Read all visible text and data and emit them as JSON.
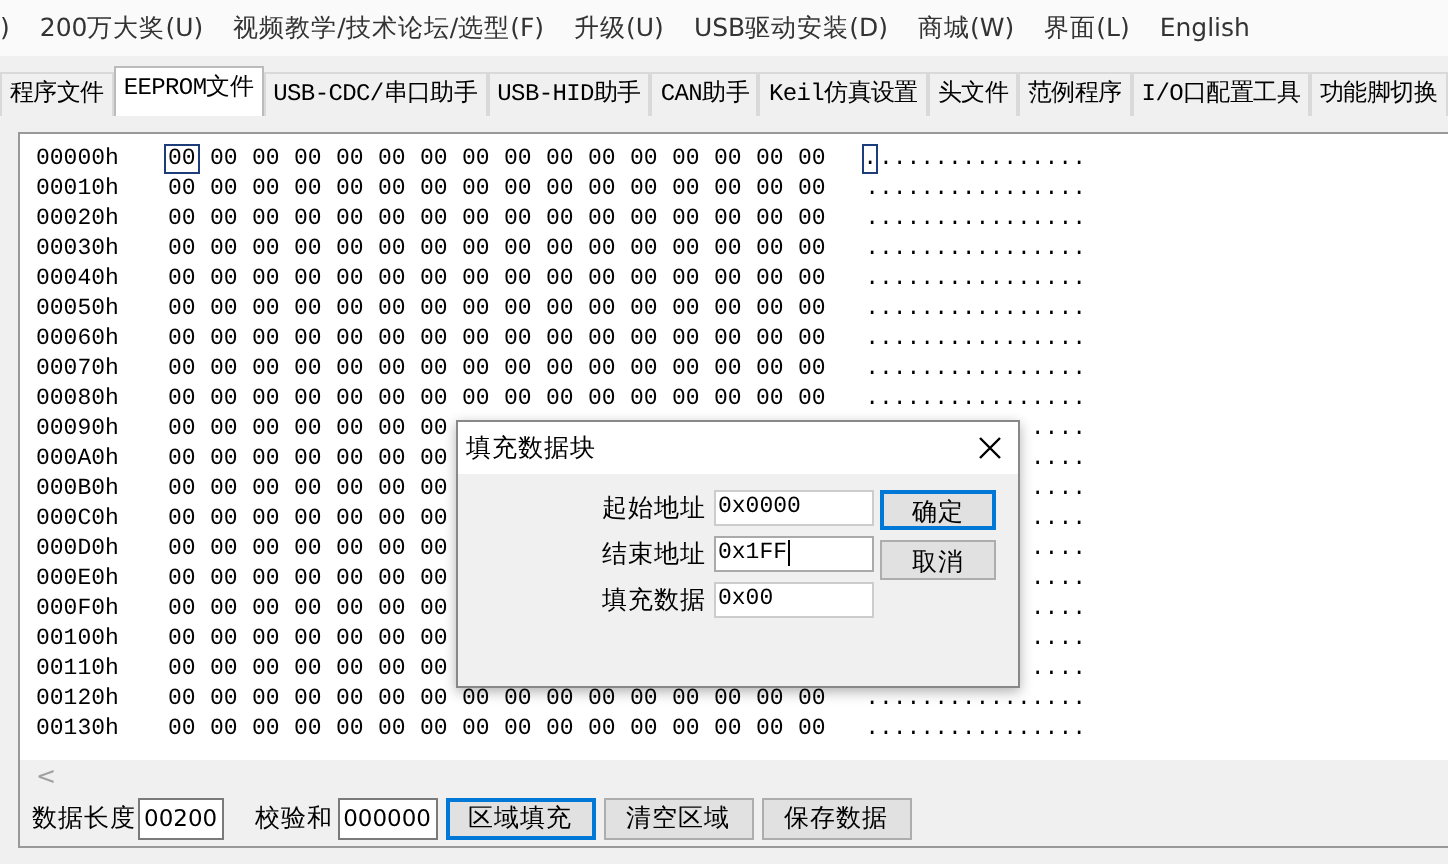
{
  "menu": [
    {
      "label": ")"
    },
    {
      "label": "200万大奖(U)"
    },
    {
      "label": "视频教学/技术论坛/选型(F)"
    },
    {
      "label": "升级(U)"
    },
    {
      "label": "USB驱动安装(D)"
    },
    {
      "label": "商城(W)"
    },
    {
      "label": "界面(L)"
    },
    {
      "label": "English"
    }
  ],
  "tabs": [
    {
      "label": "程序文件",
      "selected": false
    },
    {
      "label": "EEPROM文件",
      "selected": true
    },
    {
      "label": "USB-CDC/串口助手",
      "selected": false
    },
    {
      "label": "USB-HID助手",
      "selected": false
    },
    {
      "label": "CAN助手",
      "selected": false
    },
    {
      "label": "Keil仿真设置",
      "selected": false
    },
    {
      "label": "头文件",
      "selected": false
    },
    {
      "label": "范例程序",
      "selected": false
    },
    {
      "label": "I/O口配置工具",
      "selected": false
    },
    {
      "label": "功能脚切换",
      "selected": false
    }
  ],
  "hex_view": {
    "rows": [
      {
        "address": "00000h",
        "selected": true,
        "bytes": [
          "00",
          "00",
          "00",
          "00",
          "00",
          "00",
          "00",
          "00",
          "00",
          "00",
          "00",
          "00",
          "00",
          "00",
          "00",
          "00"
        ],
        "ascii": "................"
      },
      {
        "address": "00010h",
        "selected": false,
        "bytes": [
          "00",
          "00",
          "00",
          "00",
          "00",
          "00",
          "00",
          "00",
          "00",
          "00",
          "00",
          "00",
          "00",
          "00",
          "00",
          "00"
        ],
        "ascii": "................"
      },
      {
        "address": "00020h",
        "selected": false,
        "bytes": [
          "00",
          "00",
          "00",
          "00",
          "00",
          "00",
          "00",
          "00",
          "00",
          "00",
          "00",
          "00",
          "00",
          "00",
          "00",
          "00"
        ],
        "ascii": "................"
      },
      {
        "address": "00030h",
        "selected": false,
        "bytes": [
          "00",
          "00",
          "00",
          "00",
          "00",
          "00",
          "00",
          "00",
          "00",
          "00",
          "00",
          "00",
          "00",
          "00",
          "00",
          "00"
        ],
        "ascii": "................"
      },
      {
        "address": "00040h",
        "selected": false,
        "bytes": [
          "00",
          "00",
          "00",
          "00",
          "00",
          "00",
          "00",
          "00",
          "00",
          "00",
          "00",
          "00",
          "00",
          "00",
          "00",
          "00"
        ],
        "ascii": "................"
      },
      {
        "address": "00050h",
        "selected": false,
        "bytes": [
          "00",
          "00",
          "00",
          "00",
          "00",
          "00",
          "00",
          "00",
          "00",
          "00",
          "00",
          "00",
          "00",
          "00",
          "00",
          "00"
        ],
        "ascii": "................"
      },
      {
        "address": "00060h",
        "selected": false,
        "bytes": [
          "00",
          "00",
          "00",
          "00",
          "00",
          "00",
          "00",
          "00",
          "00",
          "00",
          "00",
          "00",
          "00",
          "00",
          "00",
          "00"
        ],
        "ascii": "................"
      },
      {
        "address": "00070h",
        "selected": false,
        "bytes": [
          "00",
          "00",
          "00",
          "00",
          "00",
          "00",
          "00",
          "00",
          "00",
          "00",
          "00",
          "00",
          "00",
          "00",
          "00",
          "00"
        ],
        "ascii": "................"
      },
      {
        "address": "00080h",
        "selected": false,
        "bytes": [
          "00",
          "00",
          "00",
          "00",
          "00",
          "00",
          "00",
          "00",
          "00",
          "00",
          "00",
          "00",
          "00",
          "00",
          "00",
          "00"
        ],
        "ascii": "................"
      },
      {
        "address": "00090h",
        "selected": false,
        "bytes": [
          "00",
          "00",
          "00",
          "00",
          "00",
          "00",
          "00"
        ],
        "ascii": "...."
      },
      {
        "address": "000A0h",
        "selected": false,
        "bytes": [
          "00",
          "00",
          "00",
          "00",
          "00",
          "00",
          "00"
        ],
        "ascii": "...."
      },
      {
        "address": "000B0h",
        "selected": false,
        "bytes": [
          "00",
          "00",
          "00",
          "00",
          "00",
          "00",
          "00"
        ],
        "ascii": "...."
      },
      {
        "address": "000C0h",
        "selected": false,
        "bytes": [
          "00",
          "00",
          "00",
          "00",
          "00",
          "00",
          "00"
        ],
        "ascii": "...."
      },
      {
        "address": "000D0h",
        "selected": false,
        "bytes": [
          "00",
          "00",
          "00",
          "00",
          "00",
          "00",
          "00"
        ],
        "ascii": "...."
      },
      {
        "address": "000E0h",
        "selected": false,
        "bytes": [
          "00",
          "00",
          "00",
          "00",
          "00",
          "00",
          "00"
        ],
        "ascii": "...."
      },
      {
        "address": "000F0h",
        "selected": false,
        "bytes": [
          "00",
          "00",
          "00",
          "00",
          "00",
          "00",
          "00"
        ],
        "ascii": "...."
      },
      {
        "address": "00100h",
        "selected": false,
        "bytes": [
          "00",
          "00",
          "00",
          "00",
          "00",
          "00",
          "00"
        ],
        "ascii": "...."
      },
      {
        "address": "00110h",
        "selected": false,
        "bytes": [
          "00",
          "00",
          "00",
          "00",
          "00",
          "00",
          "00"
        ],
        "ascii": "...."
      },
      {
        "address": "00120h",
        "selected": false,
        "bytes": [
          "00",
          "00",
          "00",
          "00",
          "00",
          "00",
          "00",
          "00",
          "00",
          "00",
          "00",
          "00",
          "00",
          "00",
          "00",
          "00"
        ],
        "ascii": "................"
      },
      {
        "address": "00130h",
        "selected": false,
        "bytes": [
          "00",
          "00",
          "00",
          "00",
          "00",
          "00",
          "00",
          "00",
          "00",
          "00",
          "00",
          "00",
          "00",
          "00",
          "00",
          "00"
        ],
        "ascii": "................"
      }
    ],
    "scroll_arrow": "<"
  },
  "bottom_bar": {
    "length_label": "数据长度",
    "length_value": "00200",
    "checksum_label": "校验和",
    "checksum_value": "000000",
    "buttons": [
      {
        "label": "区域填充",
        "focused": true
      },
      {
        "label": "清空区域",
        "focused": false
      },
      {
        "label": "保存数据",
        "focused": false
      }
    ]
  },
  "dialog": {
    "title": "填充数据块",
    "fields": [
      {
        "label": "起始地址",
        "value": "0x0000",
        "focused": false
      },
      {
        "label": "结束地址",
        "value": "0x1FF",
        "focused": true
      },
      {
        "label": "填充数据",
        "value": "0x00",
        "focused": false
      }
    ],
    "buttons": [
      {
        "label": "确定",
        "default": true
      },
      {
        "label": "取消",
        "default": false
      }
    ]
  }
}
